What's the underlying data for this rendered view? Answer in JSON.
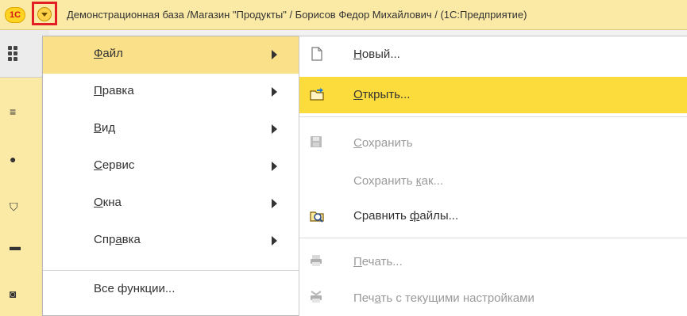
{
  "titlebar": {
    "logo_text": "1С",
    "title": "Демонстрационная база /Магазин \"Продукты\" / Борисов Федор Михайлович / (1С:Предприятие)",
    "menu_button_icon": "chevron-down-icon"
  },
  "main_menu": {
    "items": [
      {
        "label": "Файл",
        "accel": "Ф",
        "rest": "айл",
        "has_submenu": true,
        "active": true
      },
      {
        "label": "Правка",
        "accel": "П",
        "rest": "равка",
        "has_submenu": true
      },
      {
        "label": "Вид",
        "accel": "В",
        "rest": "ид",
        "has_submenu": true
      },
      {
        "label": "Сервис",
        "accel": "С",
        "rest": "ервис",
        "has_submenu": true
      },
      {
        "label": "Окна",
        "accel": "О",
        "rest": "кна",
        "has_submenu": true
      },
      {
        "label": "Справка",
        "pre": "Спр",
        "accel": "а",
        "rest": "вка",
        "has_submenu": true
      },
      {
        "label": "Все функции...",
        "has_submenu": false
      }
    ]
  },
  "submenu": {
    "items": [
      {
        "label": "Новый...",
        "accel": "Н",
        "rest": "овый...",
        "icon": "new-document-icon",
        "enabled": true
      },
      {
        "label": "Открыть...",
        "accel": "О",
        "rest": "ткрыть...",
        "icon": "open-folder-icon",
        "enabled": true,
        "active": true
      },
      {
        "label": "Сохранить",
        "accel": "С",
        "rest": "охранить",
        "icon": "save-disk-icon",
        "enabled": false
      },
      {
        "label": "Сохранить как...",
        "pre": "Сохранить ",
        "accel": "к",
        "rest": "ак...",
        "icon": "",
        "enabled": false
      },
      {
        "label": "Сравнить файлы...",
        "pre": "Сравнить ",
        "accel": "ф",
        "rest": "айлы...",
        "icon": "compare-files-icon",
        "enabled": true
      },
      {
        "label": "Печать...",
        "accel": "П",
        "rest": "ечать...",
        "icon": "printer-icon",
        "enabled": false
      },
      {
        "label": "Печать с текущими настройками",
        "pre": "Печ",
        "accel": "а",
        "rest": "ть с текущими настройками",
        "icon": "quick-print-icon",
        "enabled": false
      }
    ]
  },
  "colors": {
    "highlight": "#fcdc3c",
    "main_active": "#fbe08a",
    "titlebar": "#fbe9a6",
    "red_frame": "#e31f26"
  }
}
